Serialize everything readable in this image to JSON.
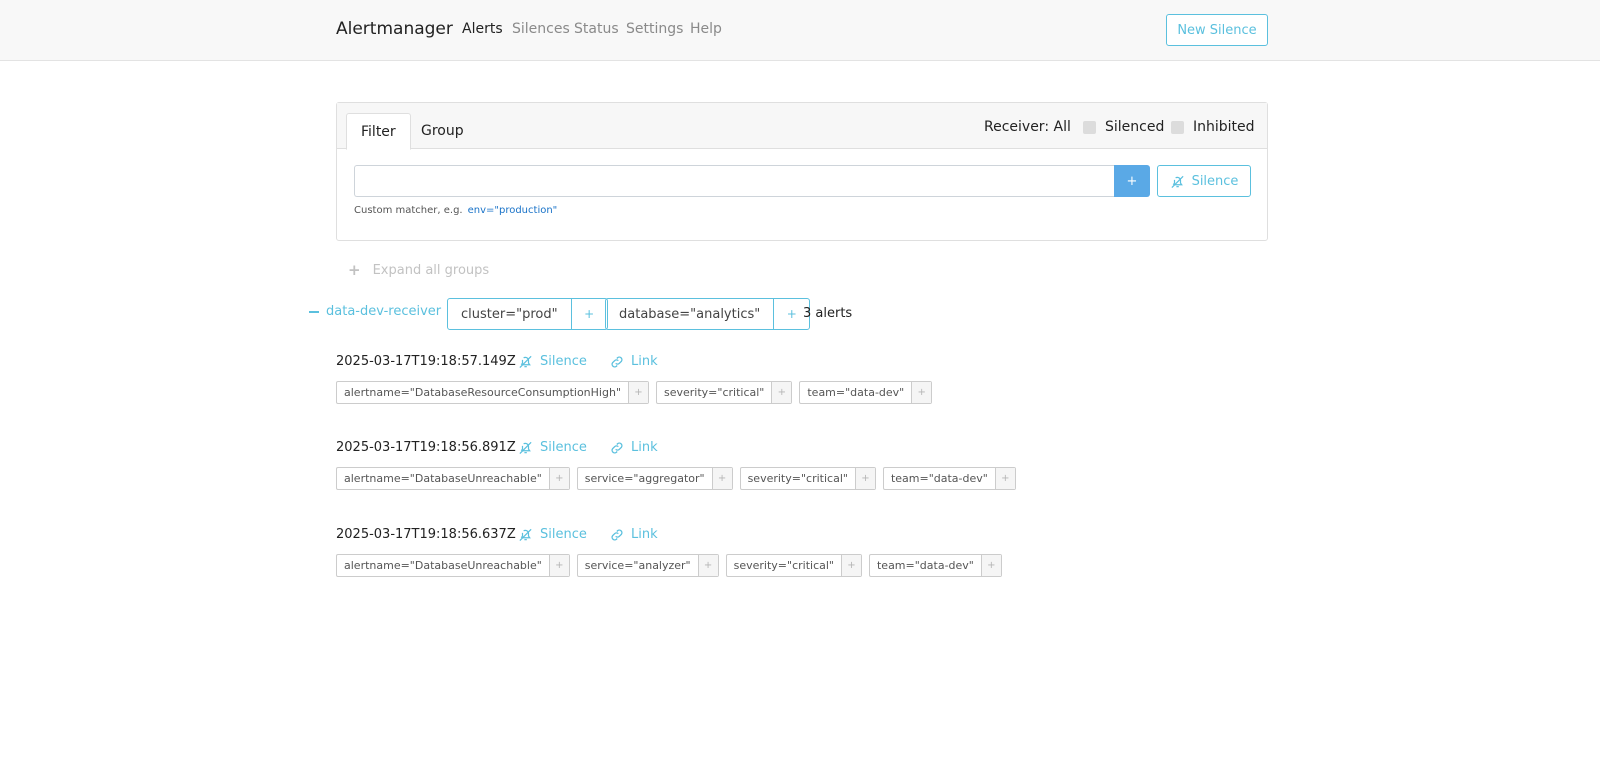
{
  "navbar": {
    "brand": "Alertmanager",
    "links": [
      "Alerts",
      "Silences",
      "Status",
      "Settings",
      "Help"
    ],
    "active": "Alerts",
    "new_silence": "New Silence"
  },
  "filter_card": {
    "tabs": [
      "Filter",
      "Group"
    ],
    "active_tab": "Filter",
    "receiver": "Receiver: All",
    "silenced": "Silenced",
    "inhibited": "Inhibited",
    "input_value": "",
    "add_button": "+",
    "silence_button": "Silence",
    "hint": "Custom matcher, e.g.",
    "hint_example": "env=\"production\""
  },
  "expand_all": "Expand all groups",
  "group": {
    "receiver": "data-dev-receiver",
    "labels": [
      "cluster=\"prod\"",
      "database=\"analytics\""
    ],
    "add": "+",
    "count": "3 alerts"
  },
  "alert_actions": {
    "silence": "Silence",
    "link": "Link"
  },
  "alerts": [
    {
      "time": "2025-03-17T19:18:57.149Z",
      "labels": [
        "alertname=\"DatabaseResourceConsumptionHigh\"",
        "severity=\"critical\"",
        "team=\"data-dev\""
      ]
    },
    {
      "time": "2025-03-17T19:18:56.891Z",
      "labels": [
        "alertname=\"DatabaseUnreachable\"",
        "service=\"aggregator\"",
        "severity=\"critical\"",
        "team=\"data-dev\""
      ]
    },
    {
      "time": "2025-03-17T19:18:56.637Z",
      "labels": [
        "alertname=\"DatabaseUnreachable\"",
        "service=\"analyzer\"",
        "severity=\"critical\"",
        "team=\"data-dev\""
      ]
    }
  ],
  "colors": {
    "accent": "#5bc0de",
    "primary": "#5aa9e6",
    "navbar_bg": "#f8f8f8"
  },
  "icons": {
    "silence": "bell-slash-icon",
    "link": "link-icon",
    "expand": "plus-icon",
    "collapse": "minus-icon"
  }
}
